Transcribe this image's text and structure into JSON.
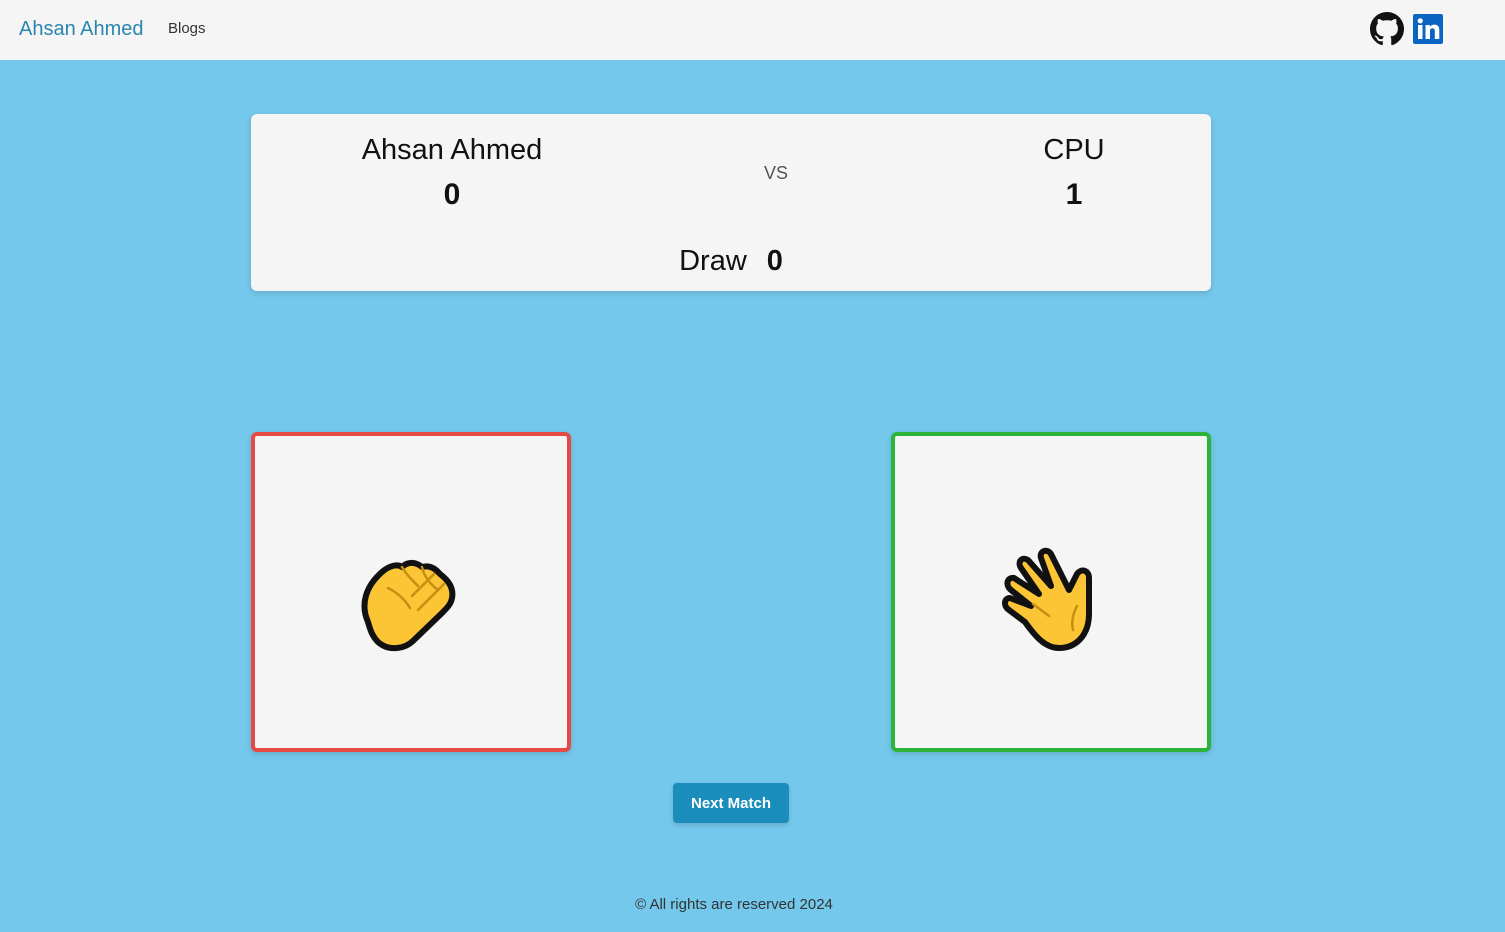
{
  "navbar": {
    "brand": "Ahsan Ahmed",
    "links": [
      {
        "label": "Blogs"
      }
    ],
    "social": [
      {
        "icon": "github-icon"
      },
      {
        "icon": "linkedin-icon"
      }
    ]
  },
  "scoreboard": {
    "player": {
      "name": "Ahsan Ahmed",
      "score": "0"
    },
    "vs_label": "VS",
    "cpu": {
      "name": "CPU",
      "score": "1"
    },
    "draw": {
      "label": "Draw",
      "count": "0"
    }
  },
  "choices": {
    "player": {
      "icon": "rock-fist-icon",
      "status": "lose",
      "border_color": "#e64a45"
    },
    "cpu": {
      "icon": "paper-hand-icon",
      "status": "win",
      "border_color": "#2bb33a"
    }
  },
  "actions": {
    "next_match_label": "Next Match"
  },
  "footer": {
    "text": "© All rights are reserved 2024"
  },
  "colors": {
    "background": "#74c8eb",
    "panel": "#f5f5f5",
    "brand": "#2a86ad",
    "button": "#1a8dbd"
  }
}
